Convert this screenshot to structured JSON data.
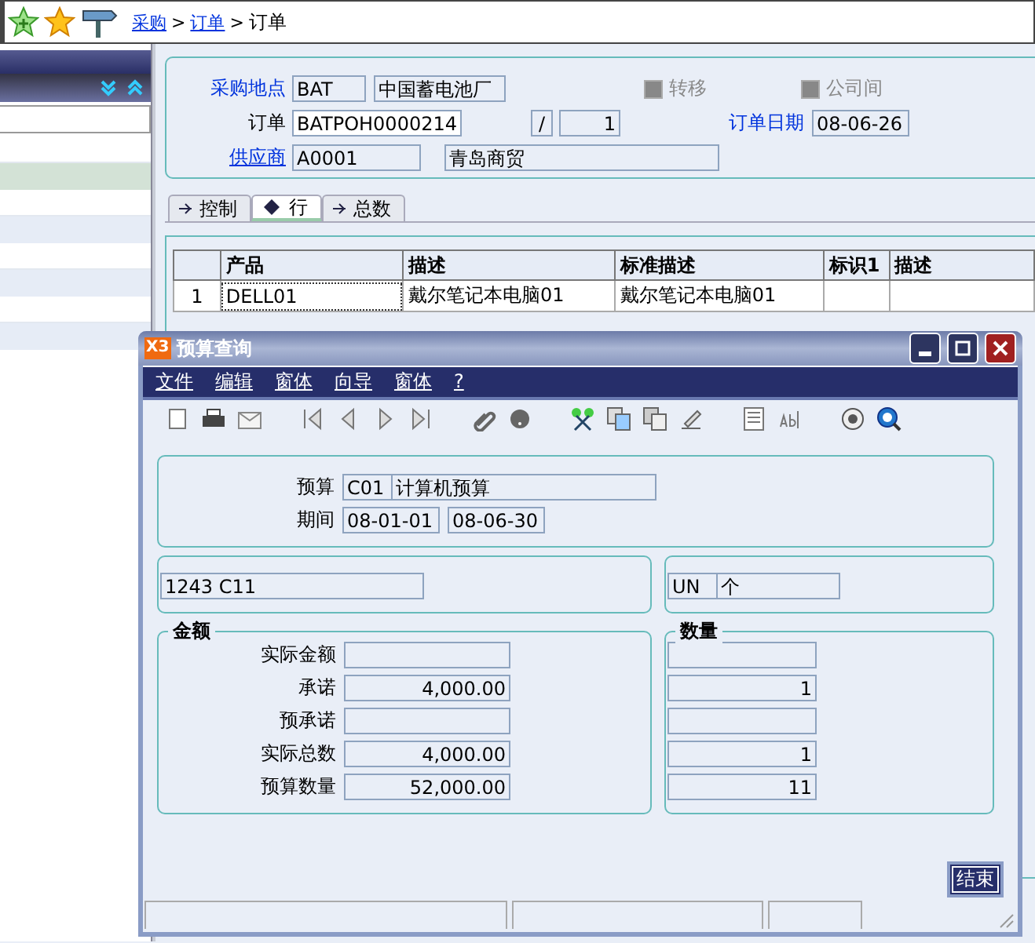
{
  "breadcrumb": [
    {
      "label": "采购",
      "link": true
    },
    {
      "label": ">",
      "link": false
    },
    {
      "label": "订单",
      "link": true
    },
    {
      "label": ">",
      "link": false
    },
    {
      "label": "订单",
      "link": false
    }
  ],
  "sidebar": {
    "rows": [
      {
        "selected": false
      },
      {
        "selected": true
      },
      {
        "selected": false
      },
      {
        "selected": false
      },
      {
        "selected": false
      },
      {
        "selected": false
      },
      {
        "selected": false
      },
      {
        "selected": false
      }
    ]
  },
  "header": {
    "site_label": "采购地点",
    "site_code": "BAT",
    "site_name": "中国蓄电池厂",
    "checkboxes": [
      {
        "label": "转移",
        "checked": false,
        "disabled": true
      },
      {
        "label": "公司间",
        "checked": false,
        "disabled": true
      }
    ],
    "order_label": "订单",
    "order_no": "BATPOH0000214",
    "separator": "/",
    "order_line": "1",
    "date_label": "订单日期",
    "date": "08-06-26",
    "supplier_label": "供应商",
    "supplier_code": "A0001",
    "supplier_name": "青岛商贸"
  },
  "tabs": [
    {
      "label": "控制",
      "selected": false
    },
    {
      "label": "行",
      "selected": true
    },
    {
      "label": "总数",
      "selected": false
    }
  ],
  "table": {
    "columns": [
      "产品",
      "描述",
      "标准描述",
      "标识1",
      "描述"
    ],
    "rows": [
      {
        "number": "1",
        "cells": [
          "DELL01",
          "戴尔笔记本电脑01",
          "戴尔笔记本电脑01"
        ]
      }
    ]
  },
  "dialog": {
    "title": "预算查询",
    "logo": "X3",
    "menu": [
      "文件",
      "编辑",
      "窗体",
      "向导",
      "窗体",
      "?"
    ],
    "budget_label": "预算",
    "budget_code": "C01",
    "budget_name": "计算机预算",
    "period_label": "期间",
    "period_from": "08-01-01",
    "period_to": "08-06-30",
    "account": "1243 C11",
    "unit_code": "UN",
    "unit_name": "个",
    "amount_title": "金额",
    "quantity_title": "数量",
    "rows": [
      {
        "label": "实际金额"
      },
      {
        "label": "承诺",
        "amount": "4,000.00",
        "quantity": "1"
      },
      {
        "label": "预承诺"
      },
      {
        "label": "实际总数",
        "amount": "4,000.00",
        "quantity": "1"
      },
      {
        "label": "预算数量",
        "amount": "52,000.00",
        "quantity": "11"
      }
    ],
    "close_button": "结束"
  }
}
